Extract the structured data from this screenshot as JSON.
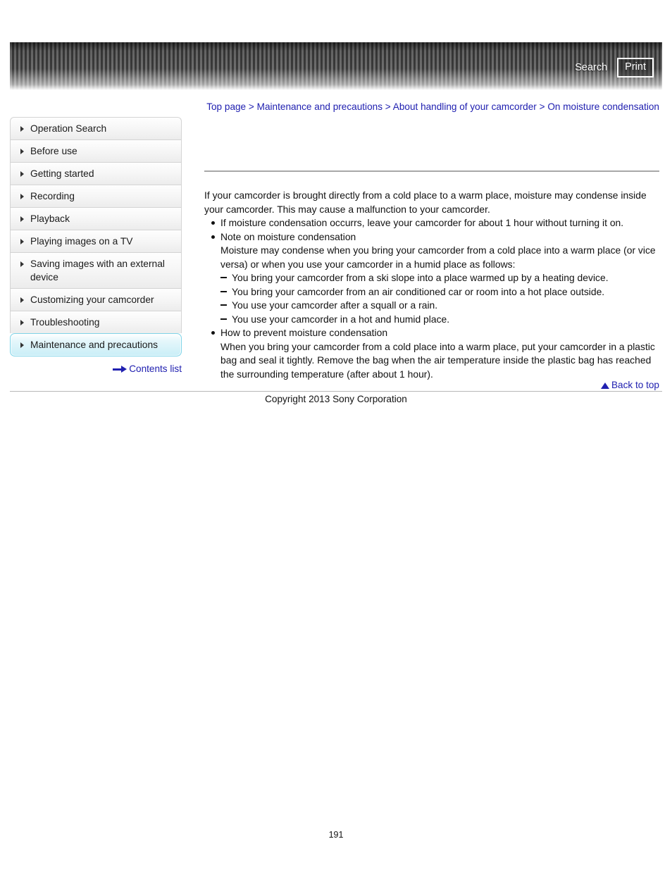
{
  "header": {
    "search_label": "Search",
    "print_label": "Print"
  },
  "breadcrumb": {
    "items": [
      "Top page",
      "Maintenance and precautions",
      "About handling of your camcorder",
      "On moisture condensation"
    ],
    "separator": ">"
  },
  "sidebar": {
    "items": [
      {
        "label": "Operation Search",
        "active": false
      },
      {
        "label": "Before use",
        "active": false
      },
      {
        "label": "Getting started",
        "active": false
      },
      {
        "label": "Recording",
        "active": false
      },
      {
        "label": "Playback",
        "active": false
      },
      {
        "label": "Playing images on a TV",
        "active": false
      },
      {
        "label": "Saving images with an external device",
        "active": false
      },
      {
        "label": "Customizing your camcorder",
        "active": false
      },
      {
        "label": "Troubleshooting",
        "active": false
      },
      {
        "label": "Maintenance and precautions",
        "active": true
      }
    ],
    "contents_list_label": "Contents list"
  },
  "main": {
    "intro": "If your camcorder is brought directly from a cold place to a warm place, moisture may condense inside your camcorder. This may cause a malfunction to your camcorder.",
    "bullets": [
      {
        "text": "If moisture condensation occurrs, leave your camcorder for about 1 hour without turning it on.",
        "detail": "",
        "sub_items": []
      },
      {
        "text": "Note on moisture condensation",
        "detail": "Moisture may condense when you bring your camcorder from a cold place into a warm place (or vice versa) or when you use your camcorder in a humid place as follows:",
        "sub_items": [
          "You bring your camcorder from a ski slope into a place warmed up by a heating device.",
          "You bring your camcorder from an air conditioned car or room into a hot place outside.",
          "You use your camcorder after a squall or a rain.",
          "You use your camcorder in a hot and humid place."
        ]
      },
      {
        "text": "How to prevent moisture condensation",
        "detail": "When you bring your camcorder from a cold place into a warm place, put your camcorder in a plastic bag and seal it tightly. Remove the bag when the air temperature inside the plastic bag has reached the surrounding temperature (after about 1 hour).",
        "sub_items": []
      }
    ]
  },
  "footer": {
    "back_to_top_label": "Back to top",
    "copyright": "Copyright 2013 Sony Corporation",
    "page_number": "191"
  },
  "colors": {
    "link": "#2020b0",
    "active_nav": "#c9eef7",
    "rule": "#a8a8a8"
  }
}
